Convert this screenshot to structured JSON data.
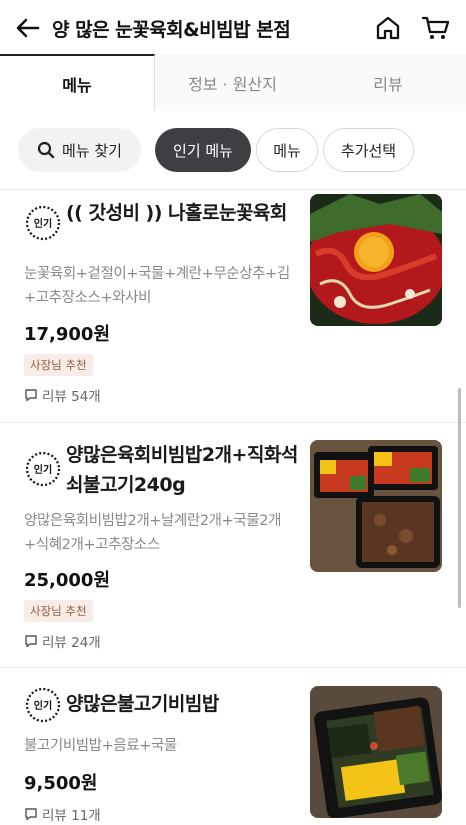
{
  "header": {
    "title": "양 많은 눈꽃육회&비빔밥 본점",
    "back_icon": "back-arrow-icon",
    "home_icon": "home-icon",
    "cart_icon": "cart-icon"
  },
  "tabs": [
    {
      "label": "메뉴"
    },
    {
      "label": "정보 · 원산지"
    },
    {
      "label": "리뷰"
    }
  ],
  "chips": {
    "search": "메뉴 찾기",
    "popular": "인기 메뉴",
    "menu": "메뉴",
    "extra": "추가선택"
  },
  "badge_label": "인기",
  "items": [
    {
      "name": "(( 갓성비 )) 나홀로눈꽃육회",
      "desc": "눈꽃육회+겉절이+국물+계란+무순상추+김+고추장소스+와사비",
      "price": "17,900원",
      "reco": "사장님 추천",
      "review": "리뷰 54개"
    },
    {
      "name": "양많은육회비빔밥2개+직화석쇠불고기240g",
      "desc": "양많은육회비빔밥2개+날계란2개+국물2개+식혜2개+고추장소스",
      "price": "25,000원",
      "reco": "사장님 추천",
      "review": "리뷰 24개"
    },
    {
      "name": "양많은불고기비빔밥",
      "desc": "불고기비빔밥+음료+국물",
      "price": "9,500원",
      "review": "리뷰 11개"
    }
  ]
}
